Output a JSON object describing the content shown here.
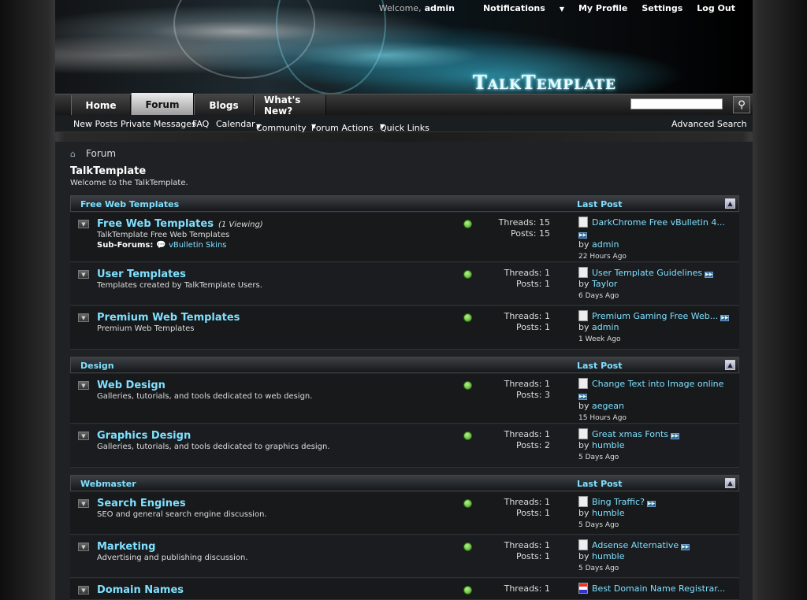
{
  "header": {
    "logo": "TalkTemplate",
    "welcome": "Welcome,",
    "user": "admin",
    "links": [
      "Notifications",
      "My Profile",
      "Settings",
      "Log Out"
    ]
  },
  "tabs": [
    "Home",
    "Forum",
    "Blogs",
    "What's New?"
  ],
  "active_tab": "Forum",
  "subnav": {
    "items": [
      "New Posts",
      "Private Messages",
      "FAQ",
      "Calendar",
      "Community",
      "Forum Actions",
      "Quick Links"
    ],
    "advanced_search": "Advanced Search"
  },
  "breadcrumb": "Forum",
  "page": {
    "title": "TalkTemplate",
    "description": "Welcome to the TalkTemplate."
  },
  "labels": {
    "last_post": "Last Post",
    "threads": "Threads:",
    "posts": "Posts:",
    "by": "by",
    "sub_forums": "Sub-Forums:"
  },
  "categories": [
    {
      "name": "Free Web Templates",
      "forums": [
        {
          "title": "Free Web Templates",
          "viewing": "(1 Viewing)",
          "desc": "TalkTemplate Free Web Templates",
          "subforum": "vBulletin Skins",
          "threads": "15",
          "posts": "15",
          "last_title": "DarkChrome Free vBulletin 4...",
          "last_by": "admin",
          "last_time": "22 Hours Ago"
        },
        {
          "title": "User Templates",
          "desc": "Templates created by TalkTemplate Users.",
          "threads": "1",
          "posts": "1",
          "last_title": "User Template Guidelines",
          "last_by": "Taylor",
          "last_time": "6 Days Ago"
        },
        {
          "title": "Premium Web Templates",
          "desc": "Premium Web Templates",
          "threads": "1",
          "posts": "1",
          "last_title": "Premium Gaming Free Web...",
          "last_by": "admin",
          "last_time": "1 Week Ago"
        }
      ]
    },
    {
      "name": "Design",
      "forums": [
        {
          "title": "Web Design",
          "desc": "Galleries, tutorials, and tools dedicated to web design.",
          "threads": "1",
          "posts": "3",
          "last_title": "Change Text into Image online",
          "last_by": "aegean",
          "last_time": "15 Hours Ago"
        },
        {
          "title": "Graphics Design",
          "desc": "Galleries, tutorials, and tools dedicated to graphics design.",
          "threads": "1",
          "posts": "2",
          "last_title": "Great xmas Fonts",
          "last_by": "humble",
          "last_time": "5 Days Ago"
        }
      ]
    },
    {
      "name": "Webmaster",
      "forums": [
        {
          "title": "Search Engines",
          "desc": "SEO and general search engine discussion.",
          "threads": "1",
          "posts": "1",
          "last_title": "Bing Traffic?",
          "last_by": "humble",
          "last_time": "5 Days Ago"
        },
        {
          "title": "Marketing",
          "desc": "Advertising and publishing discussion.",
          "threads": "1",
          "posts": "1",
          "last_title": "Adsense Alternative",
          "last_by": "humble",
          "last_time": "5 Days Ago"
        },
        {
          "title": "Domain Names",
          "threads": "1",
          "last_title": "Best Domain Name Registrar..."
        }
      ]
    }
  ]
}
